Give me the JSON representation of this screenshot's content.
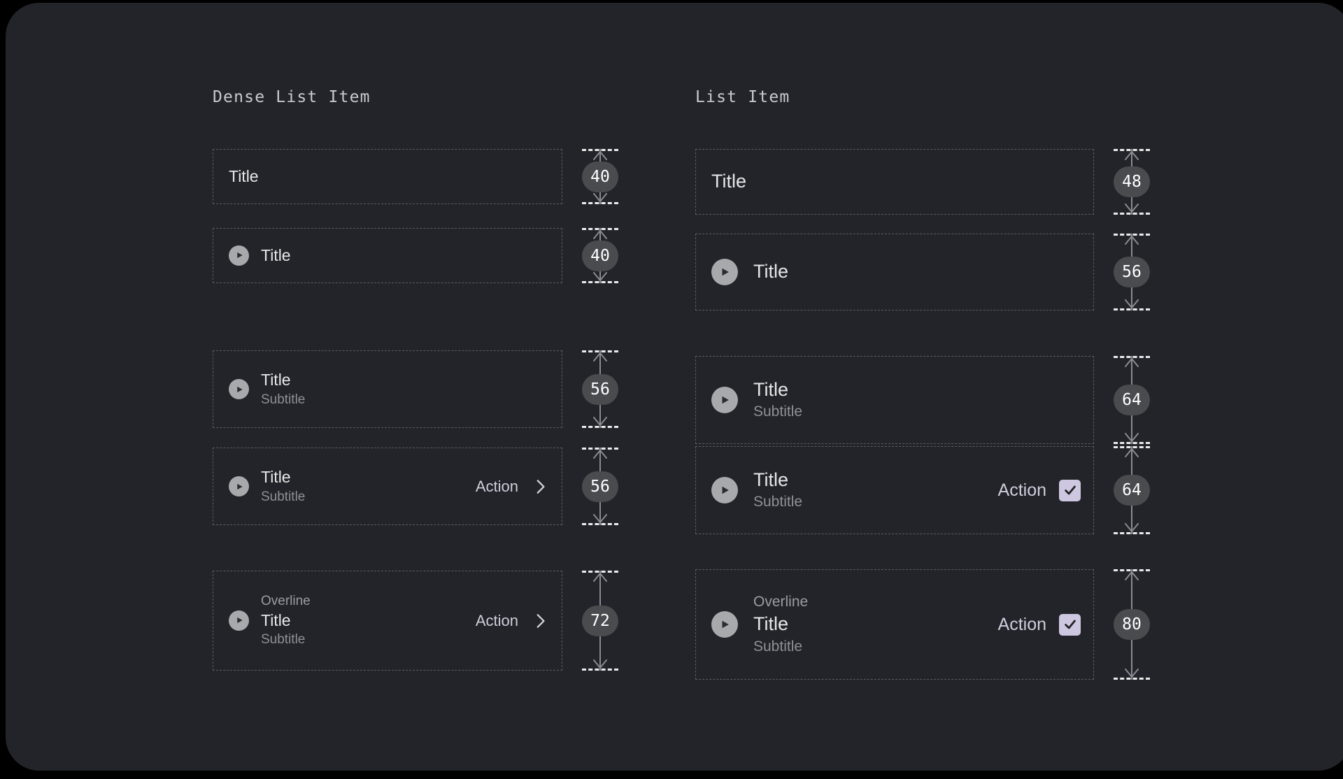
{
  "card": {
    "background": "#232429",
    "page_background": "#000000"
  },
  "colors": {
    "title": "#e7e7ea",
    "subtitle": "#8f9095",
    "overline": "#9b9ca1",
    "action": "#ccceda",
    "checkbox_accent": "#cdc7e0",
    "avatar": "#a8a9ad",
    "badge_background": "#4a4b4f",
    "dashed_border": "#5a5c62"
  },
  "columns": [
    {
      "id": "dense-list-item",
      "heading": "Dense List Item",
      "action_icon": "chevron-right-icon",
      "rows": [
        {
          "id": "dense-row-title-only",
          "height": "40",
          "avatar": false,
          "overline": null,
          "title": "Title",
          "subtitle": null,
          "action_label": null
        },
        {
          "id": "dense-row-avatar-title",
          "height": "40",
          "avatar": true,
          "overline": null,
          "title": "Title",
          "subtitle": null,
          "action_label": null
        },
        {
          "id": "dense-row-avatar-title-subtitle",
          "height": "56",
          "avatar": true,
          "overline": null,
          "title": "Title",
          "subtitle": "Subtitle",
          "action_label": null
        },
        {
          "id": "dense-row-avatar-title-subtitle-action",
          "height": "56",
          "avatar": true,
          "overline": null,
          "title": "Title",
          "subtitle": "Subtitle",
          "action_label": "Action"
        },
        {
          "id": "dense-row-overline-title-subtitle-action",
          "height": "72",
          "avatar": true,
          "overline": "Overline",
          "title": "Title",
          "subtitle": "Subtitle",
          "action_label": "Action"
        }
      ]
    },
    {
      "id": "list-item",
      "heading": "List Item",
      "action_icon": "checkbox-checked-icon",
      "rows": [
        {
          "id": "row-title-only",
          "height": "48",
          "avatar": false,
          "overline": null,
          "title": "Title",
          "subtitle": null,
          "action_label": null
        },
        {
          "id": "row-avatar-title",
          "height": "56",
          "avatar": true,
          "overline": null,
          "title": "Title",
          "subtitle": null,
          "action_label": null
        },
        {
          "id": "row-avatar-title-subtitle",
          "height": "64",
          "avatar": true,
          "overline": null,
          "title": "Title",
          "subtitle": "Subtitle",
          "action_label": null
        },
        {
          "id": "row-avatar-title-subtitle-action",
          "height": "64",
          "avatar": true,
          "overline": null,
          "title": "Title",
          "subtitle": "Subtitle",
          "action_label": "Action"
        },
        {
          "id": "row-overline-title-subtitle-action",
          "height": "80",
          "avatar": true,
          "overline": "Overline",
          "title": "Title",
          "subtitle": "Subtitle",
          "action_label": "Action"
        }
      ]
    }
  ],
  "layout": {
    "dense": {
      "tops": [
        209,
        322,
        497,
        636,
        812
      ],
      "heights": [
        79,
        79,
        111,
        111,
        143
      ]
    },
    "regular": {
      "tops": [
        209,
        330,
        505,
        634,
        810
      ],
      "heights": [
        94,
        110,
        126,
        126,
        158
      ]
    }
  },
  "icons": {
    "avatar": "play-circle-icon",
    "chevron": "chevron-right-icon",
    "checkbox": "checkbox-checked-icon"
  }
}
